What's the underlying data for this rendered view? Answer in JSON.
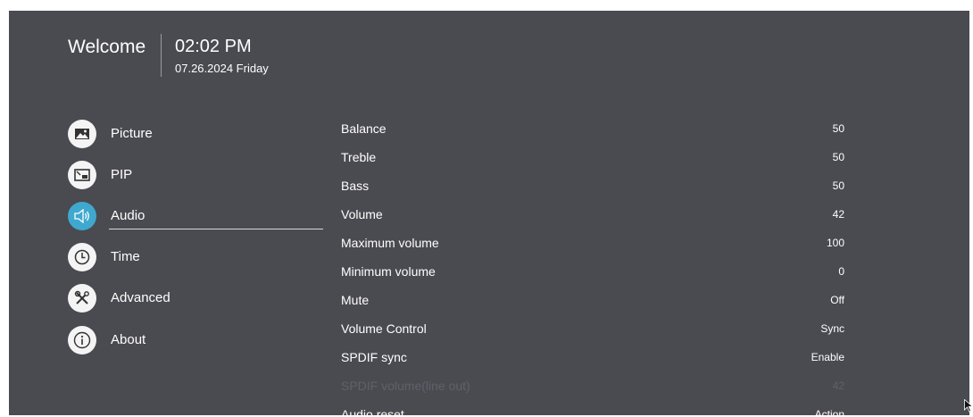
{
  "header": {
    "welcome": "Welcome",
    "time": "02:02 PM",
    "date": "07.26.2024 Friday"
  },
  "menu": {
    "items": [
      {
        "label": "Picture",
        "icon": "picture-icon"
      },
      {
        "label": "PIP",
        "icon": "pip-icon"
      },
      {
        "label": "Audio",
        "icon": "speaker-icon",
        "active": true
      },
      {
        "label": "Time",
        "icon": "clock-icon"
      },
      {
        "label": "Advanced",
        "icon": "tools-icon"
      },
      {
        "label": "About",
        "icon": "info-icon"
      }
    ]
  },
  "settings": {
    "rows": [
      {
        "label": "Balance",
        "value": "50"
      },
      {
        "label": "Treble",
        "value": "50"
      },
      {
        "label": "Bass",
        "value": "50"
      },
      {
        "label": "Volume",
        "value": "42"
      },
      {
        "label": "Maximum volume",
        "value": "100"
      },
      {
        "label": "Minimum volume",
        "value": "0"
      },
      {
        "label": "Mute",
        "value": "Off"
      },
      {
        "label": "Volume Control",
        "value": "Sync"
      },
      {
        "label": "SPDIF sync",
        "value": "Enable"
      },
      {
        "label": "SPDIF volume(line out)",
        "value": "42",
        "disabled": true
      },
      {
        "label": "Audio reset",
        "value": "Action"
      }
    ]
  },
  "colors": {
    "background": "#4a4a51",
    "accent": "#3fa8cf",
    "disabled_text": "#60606a"
  }
}
